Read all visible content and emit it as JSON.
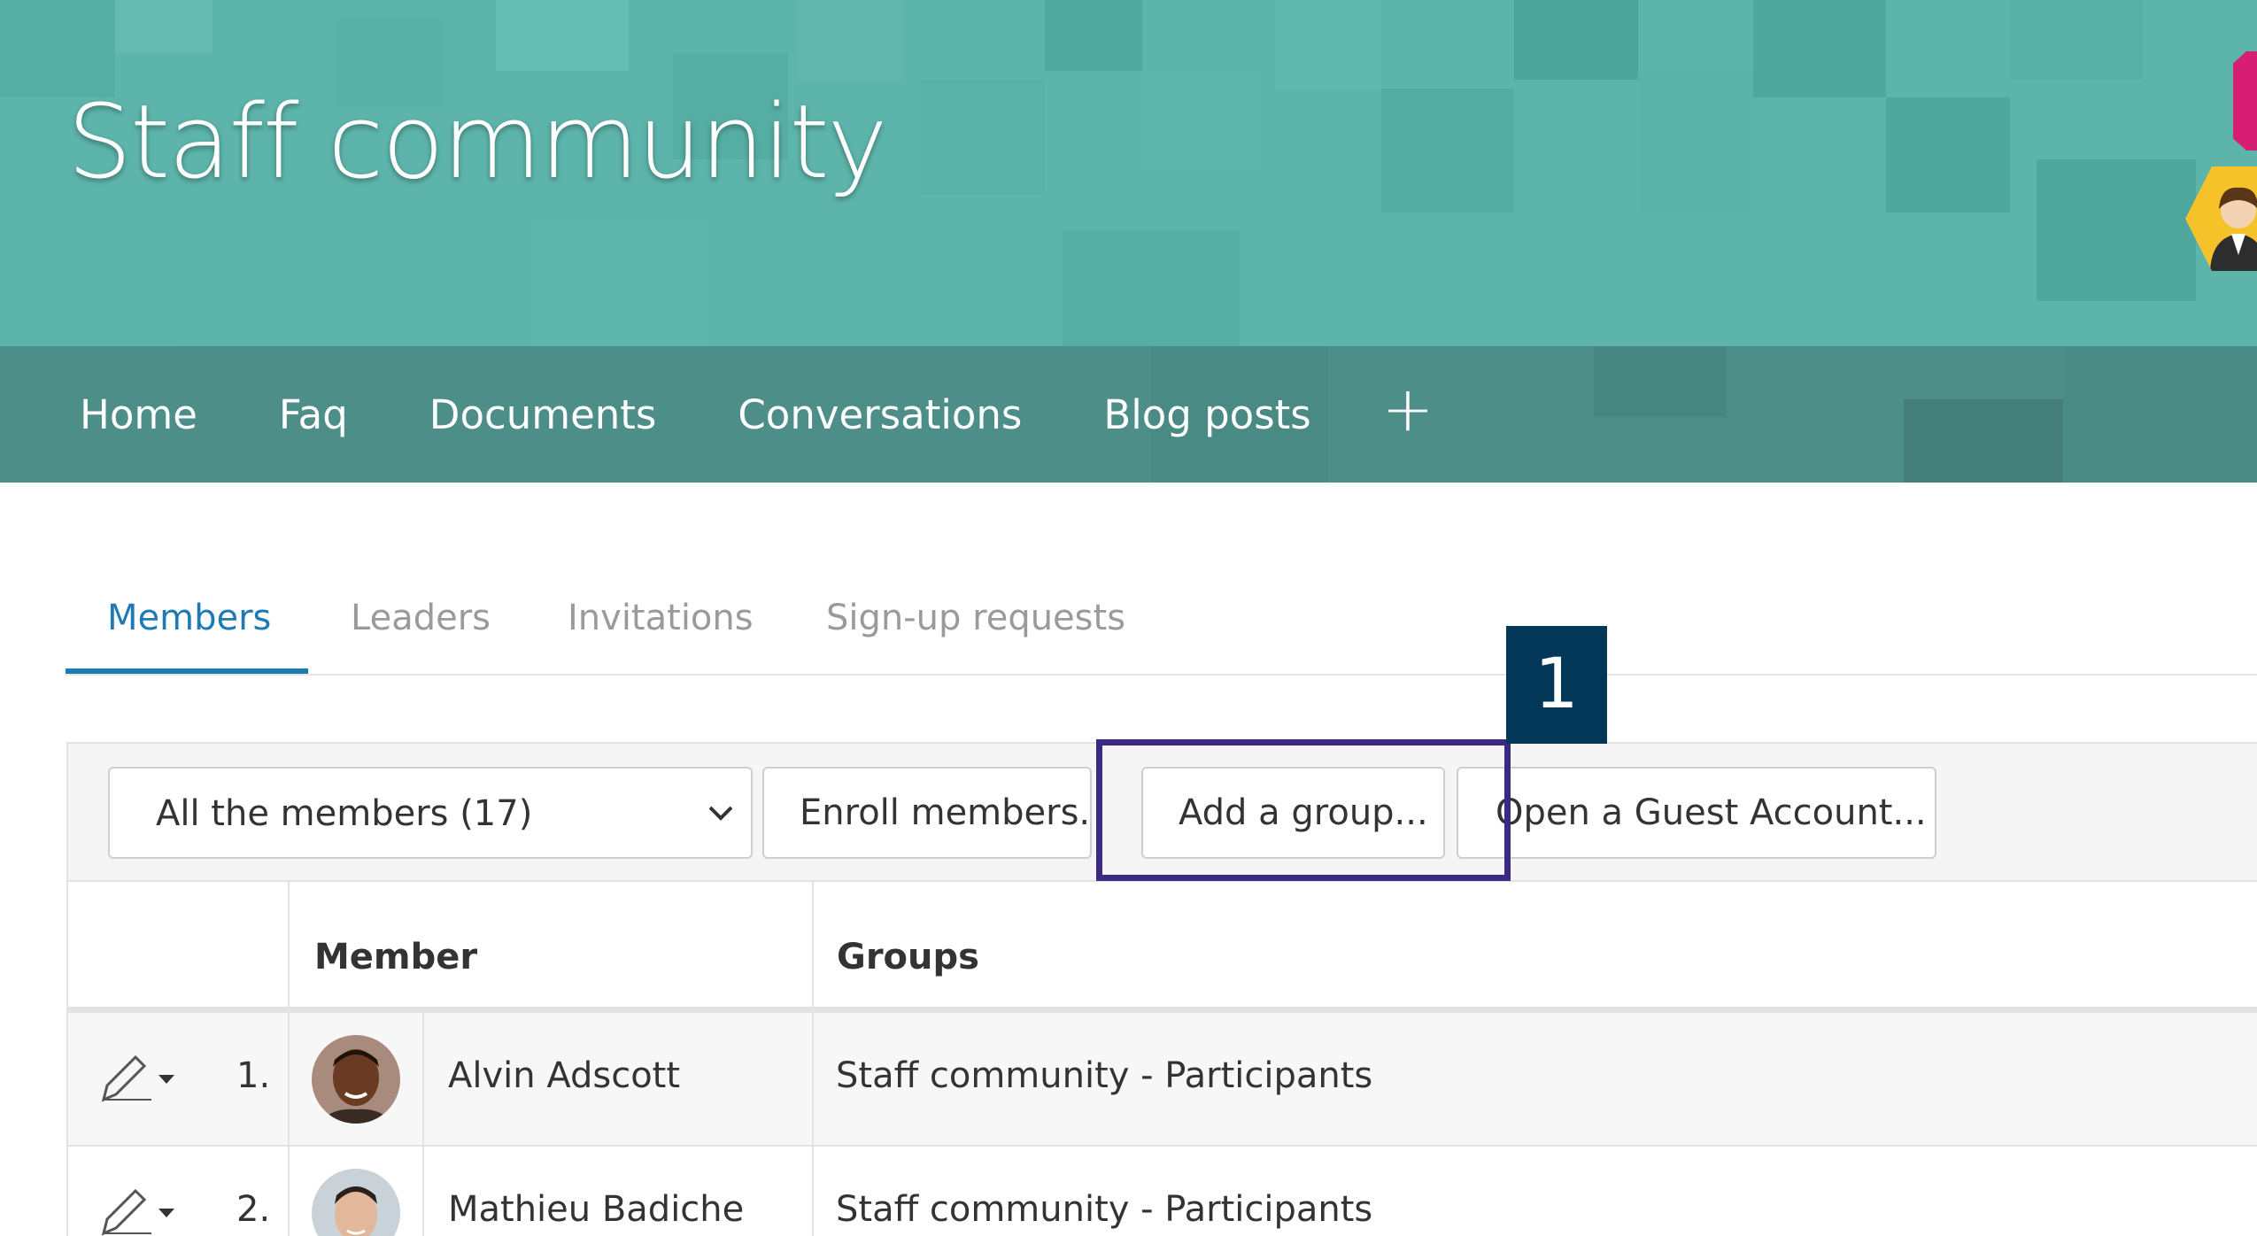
{
  "header": {
    "site_title": "Staff community"
  },
  "nav": {
    "items": [
      "Home",
      "Faq",
      "Documents",
      "Conversations",
      "Blog posts"
    ],
    "add_icon": "plus-icon"
  },
  "tabs": [
    {
      "label": "Members",
      "active": true
    },
    {
      "label": "Leaders",
      "active": false
    },
    {
      "label": "Invitations",
      "active": false
    },
    {
      "label": "Sign-up requests",
      "active": false
    }
  ],
  "toolbar": {
    "filter_value": "All the members (17)",
    "enroll_label": "Enroll members...",
    "add_group_label": "Add a group...",
    "guest_label": "Open a Guest Account..."
  },
  "callout": {
    "number": "1"
  },
  "table": {
    "columns": [
      "Member",
      "Groups"
    ],
    "rows": [
      {
        "index": "1.",
        "name": "Alvin Adscott",
        "groups": "Staff community - Participants"
      },
      {
        "index": "2.",
        "name": "Mathieu Badiche",
        "groups": "Staff community - Participants"
      }
    ]
  },
  "colors": {
    "banner": "#5db4aa",
    "navbar": "#4d8e88",
    "tab_active": "#1f7ab3",
    "callout_border": "#3b2a80",
    "callout_badge": "#023757"
  }
}
